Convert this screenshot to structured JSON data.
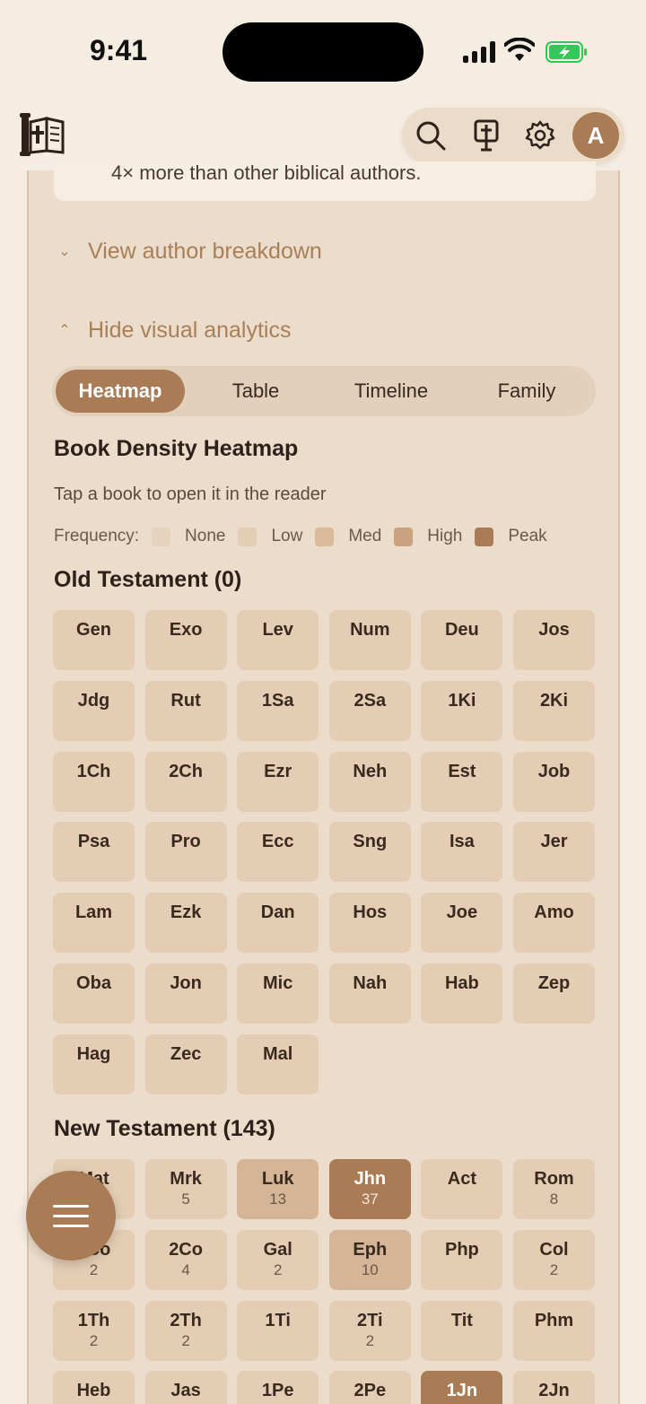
{
  "status": {
    "time": "9:41"
  },
  "header": {
    "avatar_initial": "A"
  },
  "note_text": "4× more than other biblical authors.",
  "expanders": {
    "author_breakdown": "View author breakdown",
    "visual_analytics": "Hide visual analytics"
  },
  "tabs": [
    {
      "label": "Heatmap",
      "active": true
    },
    {
      "label": "Table",
      "active": false
    },
    {
      "label": "Timeline",
      "active": false
    },
    {
      "label": "Family",
      "active": false
    }
  ],
  "heatmap": {
    "title": "Book Density Heatmap",
    "subtitle": "Tap a book to open it in the reader",
    "legend_label": "Frequency:",
    "legend": [
      {
        "label": "None",
        "color": "#e6d3be"
      },
      {
        "label": "Low",
        "color": "#e3cdb5"
      },
      {
        "label": "Med",
        "color": "#d9bb9c"
      },
      {
        "label": "High",
        "color": "#c9a27e"
      },
      {
        "label": "Peak",
        "color": "#a97c55"
      }
    ]
  },
  "old_testament": {
    "title": "Old Testament (0)",
    "books": [
      {
        "abbr": "Gen",
        "count": ""
      },
      {
        "abbr": "Exo",
        "count": ""
      },
      {
        "abbr": "Lev",
        "count": ""
      },
      {
        "abbr": "Num",
        "count": ""
      },
      {
        "abbr": "Deu",
        "count": ""
      },
      {
        "abbr": "Jos",
        "count": ""
      },
      {
        "abbr": "Jdg",
        "count": ""
      },
      {
        "abbr": "Rut",
        "count": ""
      },
      {
        "abbr": "1Sa",
        "count": ""
      },
      {
        "abbr": "2Sa",
        "count": ""
      },
      {
        "abbr": "1Ki",
        "count": ""
      },
      {
        "abbr": "2Ki",
        "count": ""
      },
      {
        "abbr": "1Ch",
        "count": ""
      },
      {
        "abbr": "2Ch",
        "count": ""
      },
      {
        "abbr": "Ezr",
        "count": ""
      },
      {
        "abbr": "Neh",
        "count": ""
      },
      {
        "abbr": "Est",
        "count": ""
      },
      {
        "abbr": "Job",
        "count": ""
      },
      {
        "abbr": "Psa",
        "count": ""
      },
      {
        "abbr": "Pro",
        "count": ""
      },
      {
        "abbr": "Ecc",
        "count": ""
      },
      {
        "abbr": "Sng",
        "count": ""
      },
      {
        "abbr": "Isa",
        "count": ""
      },
      {
        "abbr": "Jer",
        "count": ""
      },
      {
        "abbr": "Lam",
        "count": ""
      },
      {
        "abbr": "Ezk",
        "count": ""
      },
      {
        "abbr": "Dan",
        "count": ""
      },
      {
        "abbr": "Hos",
        "count": ""
      },
      {
        "abbr": "Joe",
        "count": ""
      },
      {
        "abbr": "Amo",
        "count": ""
      },
      {
        "abbr": "Oba",
        "count": ""
      },
      {
        "abbr": "Jon",
        "count": ""
      },
      {
        "abbr": "Mic",
        "count": ""
      },
      {
        "abbr": "Nah",
        "count": ""
      },
      {
        "abbr": "Hab",
        "count": ""
      },
      {
        "abbr": "Zep",
        "count": ""
      },
      {
        "abbr": "Hag",
        "count": ""
      },
      {
        "abbr": "Zec",
        "count": ""
      },
      {
        "abbr": "Mal",
        "count": ""
      }
    ]
  },
  "new_testament": {
    "title": "New Testament (143)",
    "books": [
      {
        "abbr": "Mat",
        "count": "",
        "level": "low"
      },
      {
        "abbr": "Mrk",
        "count": "5",
        "level": "low"
      },
      {
        "abbr": "Luk",
        "count": "13",
        "level": "med"
      },
      {
        "abbr": "Jhn",
        "count": "37",
        "level": "peak"
      },
      {
        "abbr": "Act",
        "count": "",
        "level": "none"
      },
      {
        "abbr": "Rom",
        "count": "8",
        "level": "low"
      },
      {
        "abbr": "1Co",
        "count": "2",
        "level": "low"
      },
      {
        "abbr": "2Co",
        "count": "4",
        "level": "low"
      },
      {
        "abbr": "Gal",
        "count": "2",
        "level": "low"
      },
      {
        "abbr": "Eph",
        "count": "10",
        "level": "med"
      },
      {
        "abbr": "Php",
        "count": "",
        "level": "none"
      },
      {
        "abbr": "Col",
        "count": "2",
        "level": "low"
      },
      {
        "abbr": "1Th",
        "count": "2",
        "level": "low"
      },
      {
        "abbr": "2Th",
        "count": "2",
        "level": "low"
      },
      {
        "abbr": "1Ti",
        "count": "",
        "level": "none"
      },
      {
        "abbr": "2Ti",
        "count": "2",
        "level": "low"
      },
      {
        "abbr": "Tit",
        "count": "",
        "level": "none"
      },
      {
        "abbr": "Phm",
        "count": "",
        "level": "none"
      },
      {
        "abbr": "Heb",
        "count": "",
        "level": "none"
      },
      {
        "abbr": "Jas",
        "count": "",
        "level": "none"
      },
      {
        "abbr": "1Pe",
        "count": "",
        "level": "none"
      },
      {
        "abbr": "2Pe",
        "count": "",
        "level": "none"
      },
      {
        "abbr": "1Jn",
        "count": "",
        "level": "peak"
      },
      {
        "abbr": "2Jn",
        "count": "",
        "level": "none"
      }
    ]
  },
  "colors": {
    "accent": "#a97c55",
    "cell_none": "#e4cdb4",
    "cell_low": "#e4cdb4",
    "cell_med": "#d4b597",
    "cell_peak": "#a97c55"
  }
}
